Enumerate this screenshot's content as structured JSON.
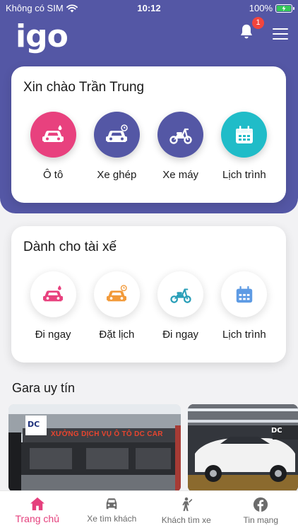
{
  "status": {
    "carrier": "Không có SIM",
    "time": "10:12",
    "battery": "100%",
    "battery_level": 1.0
  },
  "header": {
    "logo": "igo",
    "notification_count": "1"
  },
  "greeting_card": {
    "title": "Xin chào Trần Trung",
    "items": [
      {
        "label": "Ô tô",
        "icon": "car-icon",
        "color": "#e8417e"
      },
      {
        "label": "Xe ghép",
        "icon": "shared-car-icon",
        "color": "#5457a5"
      },
      {
        "label": "Xe máy",
        "icon": "motorbike-icon",
        "color": "#5457a5"
      },
      {
        "label": "Lịch trình",
        "icon": "calendar-icon",
        "color": "#20bcc8"
      }
    ]
  },
  "driver_card": {
    "title": "Dành cho tài xế",
    "items": [
      {
        "label": "Đi ngay",
        "icon": "car-icon",
        "color": "#e8417e"
      },
      {
        "label": "Đặt lịch",
        "icon": "scheduled-car-icon",
        "color": "#f29a3a"
      },
      {
        "label": "Đi ngay",
        "icon": "motorbike-icon",
        "color": "#2a9fb8"
      },
      {
        "label": "Lịch trình",
        "icon": "calendar-icon",
        "color": "#5e9be4"
      }
    ]
  },
  "gara": {
    "title": "Gara uy tín",
    "items": [
      {
        "sign": "XƯỞNG DỊCH VỤ Ô TÔ DC CAR",
        "logo": "DC"
      },
      {
        "logo": "DC"
      }
    ]
  },
  "tabbar": {
    "tabs": [
      {
        "label": "Trang chủ",
        "icon": "home-icon"
      },
      {
        "label": "Xe tìm khách",
        "icon": "car-front-icon"
      },
      {
        "label": "Khách tìm xe",
        "icon": "person-icon"
      },
      {
        "label": "Tin mạng",
        "icon": "facebook-icon"
      }
    ]
  },
  "colors": {
    "primary": "#5457a5",
    "accent": "#e5407d",
    "teal": "#20bcc8"
  }
}
